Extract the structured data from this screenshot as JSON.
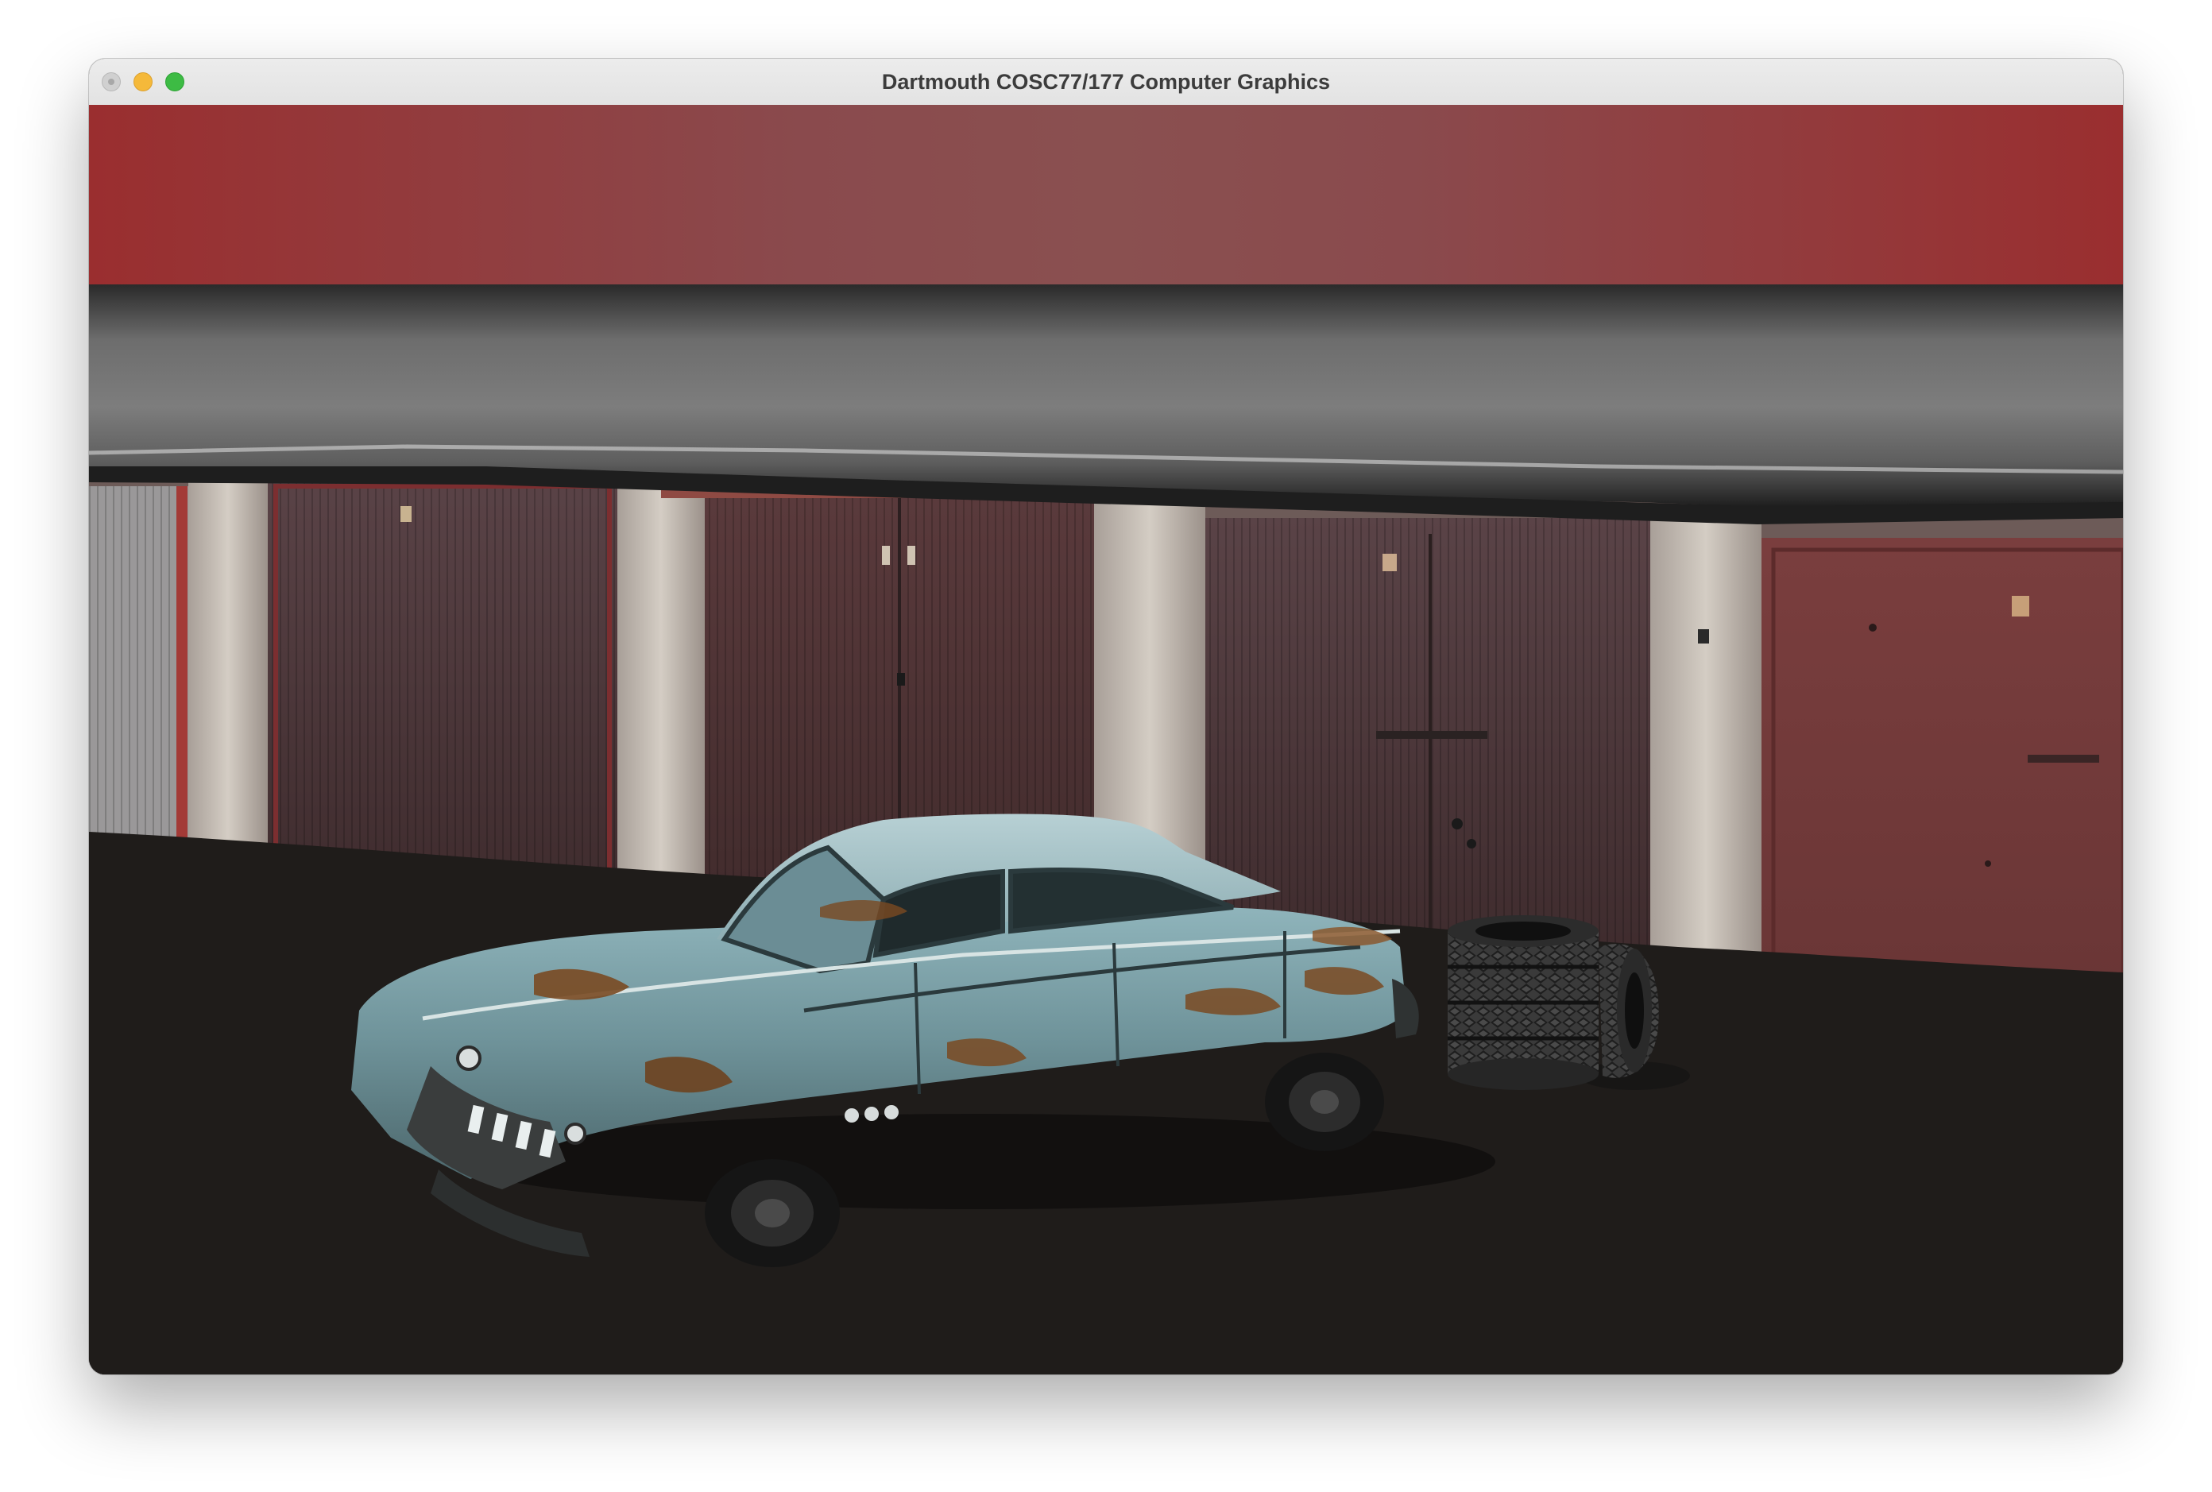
{
  "window": {
    "title": "Dartmouth COSC77/177 Computer Graphics"
  },
  "icons": {
    "close": "close-icon",
    "minimize": "minimize-icon",
    "maximize": "maximize-icon"
  },
  "colors": {
    "sky": "#8a4b4d",
    "sky_edge": "#9a2e2f",
    "ground": "#1f1c1a",
    "car_body": "#6f98a0",
    "rust": "#7a4a22",
    "tires": "#2b2b2b"
  }
}
